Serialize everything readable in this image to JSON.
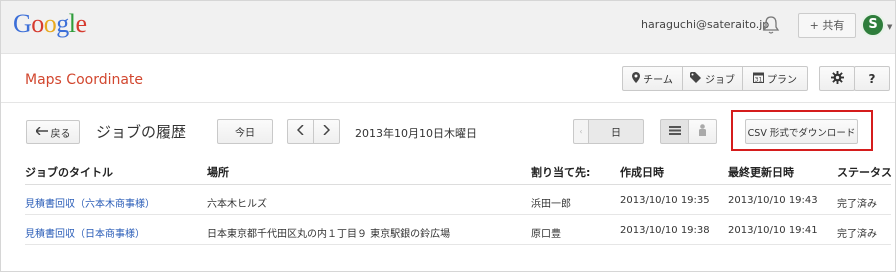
{
  "google_bar": {
    "logo": [
      "G",
      "o",
      "o",
      "g",
      "l",
      "e"
    ],
    "account_email": "haraguchi@sateraito.jp",
    "share_label": "+ 共有",
    "avatar_letter": "S"
  },
  "app_bar": {
    "title": "Maps Coordinate",
    "team_label": "チーム",
    "job_label": "ジョブ",
    "plan_label": "プラン",
    "help_label": "?"
  },
  "toolbar": {
    "back_label": "戻る",
    "page_title": "ジョブの履歴",
    "today_label": "今日",
    "date_text": "2013年10月10日木曜日",
    "day_label": "日",
    "csv_label": "CSV 形式でダウンロード"
  },
  "table": {
    "headers": [
      "ジョブのタイトル",
      "場所",
      "割り当て先:",
      "作成日時",
      "最終更新日時",
      "ステータス"
    ],
    "rows": [
      {
        "title": "見積書回収（六本木商事様）",
        "location": "六本木ヒルズ",
        "assignee": "浜田一郎",
        "created": "2013/10/10 19:35",
        "updated": "2013/10/10 19:43",
        "status": "完了済み"
      },
      {
        "title": "見積書回収（日本商事様）",
        "location": "日本東京都千代田区丸の内１丁目９ 東京駅銀の鈴広場",
        "assignee": "原口豊",
        "created": "2013/10/10 19:38",
        "updated": "2013/10/10 19:41",
        "status": "完了済み"
      }
    ]
  },
  "colors": {
    "app_title": "#d2472f",
    "link": "#2a5db8",
    "highlight_box": "#d51c1c"
  },
  "icons": [
    "bell-icon",
    "pin-icon",
    "tag-icon",
    "calendar-icon",
    "gear-icon",
    "back-arrow-icon",
    "chevron-left-icon",
    "chevron-right-icon",
    "list-view-icon",
    "person-icon"
  ]
}
